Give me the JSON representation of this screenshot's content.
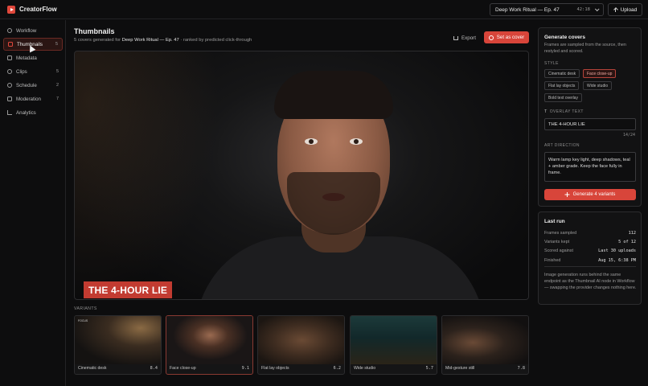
{
  "app": {
    "name": "CreatorFlow"
  },
  "header": {
    "episode": {
      "title": "Deep Work Ritual — Ep. 47",
      "duration": "42:18"
    },
    "upload_label": "Upload"
  },
  "sidebar": {
    "items": [
      {
        "label": "Workflow",
        "count": ""
      },
      {
        "label": "Thumbnails",
        "count": "5"
      },
      {
        "label": "Metadata",
        "count": ""
      },
      {
        "label": "Clips",
        "count": "5"
      },
      {
        "label": "Schedule",
        "count": "2"
      },
      {
        "label": "Moderation",
        "count": "7"
      },
      {
        "label": "Analytics",
        "count": ""
      }
    ]
  },
  "main": {
    "title": "Thumbnails",
    "subtitle_prefix": "5 covers generated for ",
    "subtitle_episode": "Deep Work Ritual — Ep. 47",
    "subtitle_suffix": " · ranked by predicted click-through",
    "export_label": "Export",
    "set_cover_label": "Set as cover",
    "hero_overlay": "THE 4-HOUR LIE",
    "variants_label": "VARIANTS",
    "variants": [
      {
        "name": "Cinematic desk",
        "score": "8.4",
        "tag": "FOCUS"
      },
      {
        "name": "Face close-up",
        "score": "9.1",
        "tag": ""
      },
      {
        "name": "Flat lay objects",
        "score": "6.2",
        "tag": ""
      },
      {
        "name": "Wide studio",
        "score": "5.7",
        "tag": ""
      },
      {
        "name": "Mid-gesture still",
        "score": "7.8",
        "tag": ""
      }
    ]
  },
  "generate_panel": {
    "title": "Generate covers",
    "description": "Frames are sampled from the source, then restyled and scored.",
    "style_label": "STYLE",
    "styles": [
      {
        "label": "Cinematic desk",
        "selected": false
      },
      {
        "label": "Face close-up",
        "selected": true
      },
      {
        "label": "Flat lay objects",
        "selected": false
      },
      {
        "label": "Wide studio",
        "selected": false
      },
      {
        "label": "Bold text overlay",
        "selected": false
      }
    ],
    "overlay_text_label": "OVERLAY TEXT",
    "overlay_text_value": "THE 4-HOUR LIE",
    "overlay_char_count": "14/24",
    "art_direction_label": "ART DIRECTION",
    "art_direction_value": "Warm lamp key light, deep shadows, teal + amber grade. Keep the face fully in frame.",
    "generate_label": "Generate 4 variants"
  },
  "last_run": {
    "title": "Last run",
    "rows": [
      {
        "key": "Frames sampled",
        "value": "112"
      },
      {
        "key": "Variants kept",
        "value": "5 of 12"
      },
      {
        "key": "Scored against",
        "value": "Last 30 uploads"
      },
      {
        "key": "Finished",
        "value": "Aug 15, 6:38 PM"
      }
    ],
    "note": "Image generation runs behind the same endpoint as the Thumbnail AI node in Workflow — swapping the provider changes nothing here."
  },
  "colors": {
    "accent": "#d8453a",
    "background": "#0d0d0e",
    "panel": "#121213"
  }
}
